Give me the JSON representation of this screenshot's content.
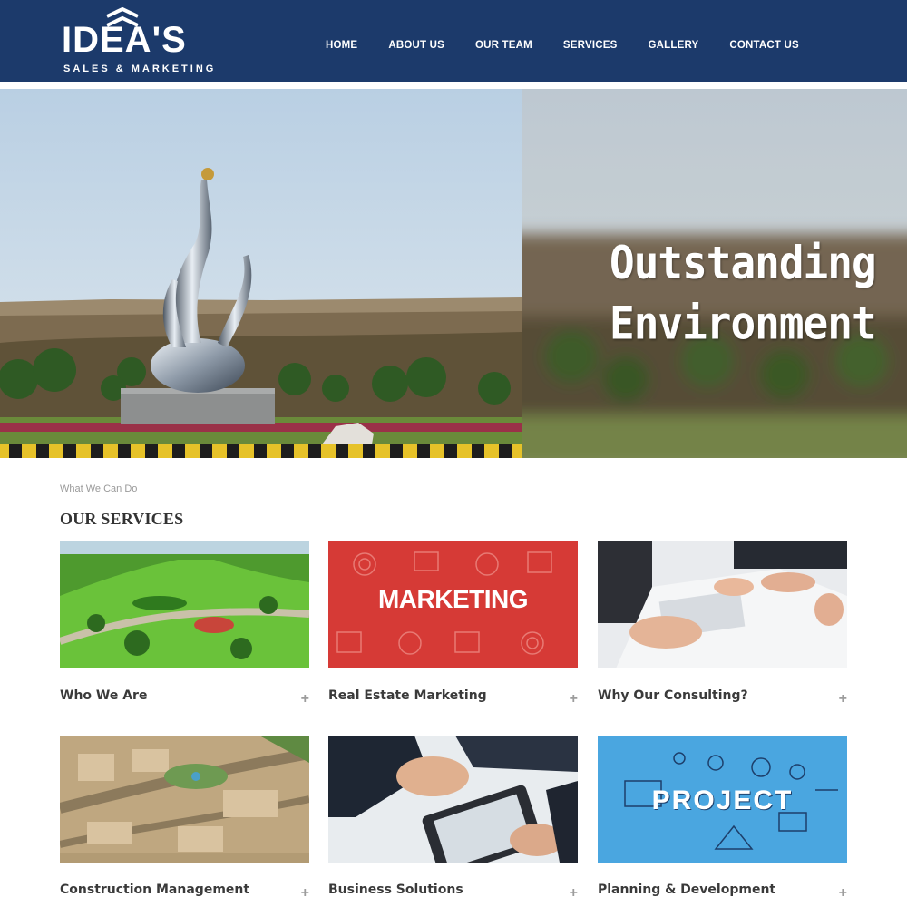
{
  "logo": {
    "main": "IDEA'S",
    "sub": "SALES & MARKETING"
  },
  "nav": {
    "items": [
      {
        "label": "HOME"
      },
      {
        "label": "ABOUT US"
      },
      {
        "label": "OUR TEAM"
      },
      {
        "label": "SERVICES"
      },
      {
        "label": "GALLERY"
      },
      {
        "label": "CONTACT US"
      }
    ]
  },
  "hero": {
    "line1": "Outstanding",
    "line2": "Environment"
  },
  "services": {
    "eyebrow": "What We Can Do",
    "title": "OUR SERVICES",
    "marketing_image_text": "MARKETING",
    "project_image_text": "PROJECT",
    "cards": [
      {
        "label": "Who We Are"
      },
      {
        "label": "Real Estate Marketing"
      },
      {
        "label": "Why Our Consulting?"
      },
      {
        "label": "Construction Management"
      },
      {
        "label": "Business Solutions"
      },
      {
        "label": "Planning & Development"
      }
    ]
  },
  "colors": {
    "header_bg": "#1c3a6b",
    "marketing_red": "#d63a36",
    "project_blue": "#4aa6e0"
  },
  "icons": [
    "plus-icon",
    "logo-mark-icon"
  ]
}
